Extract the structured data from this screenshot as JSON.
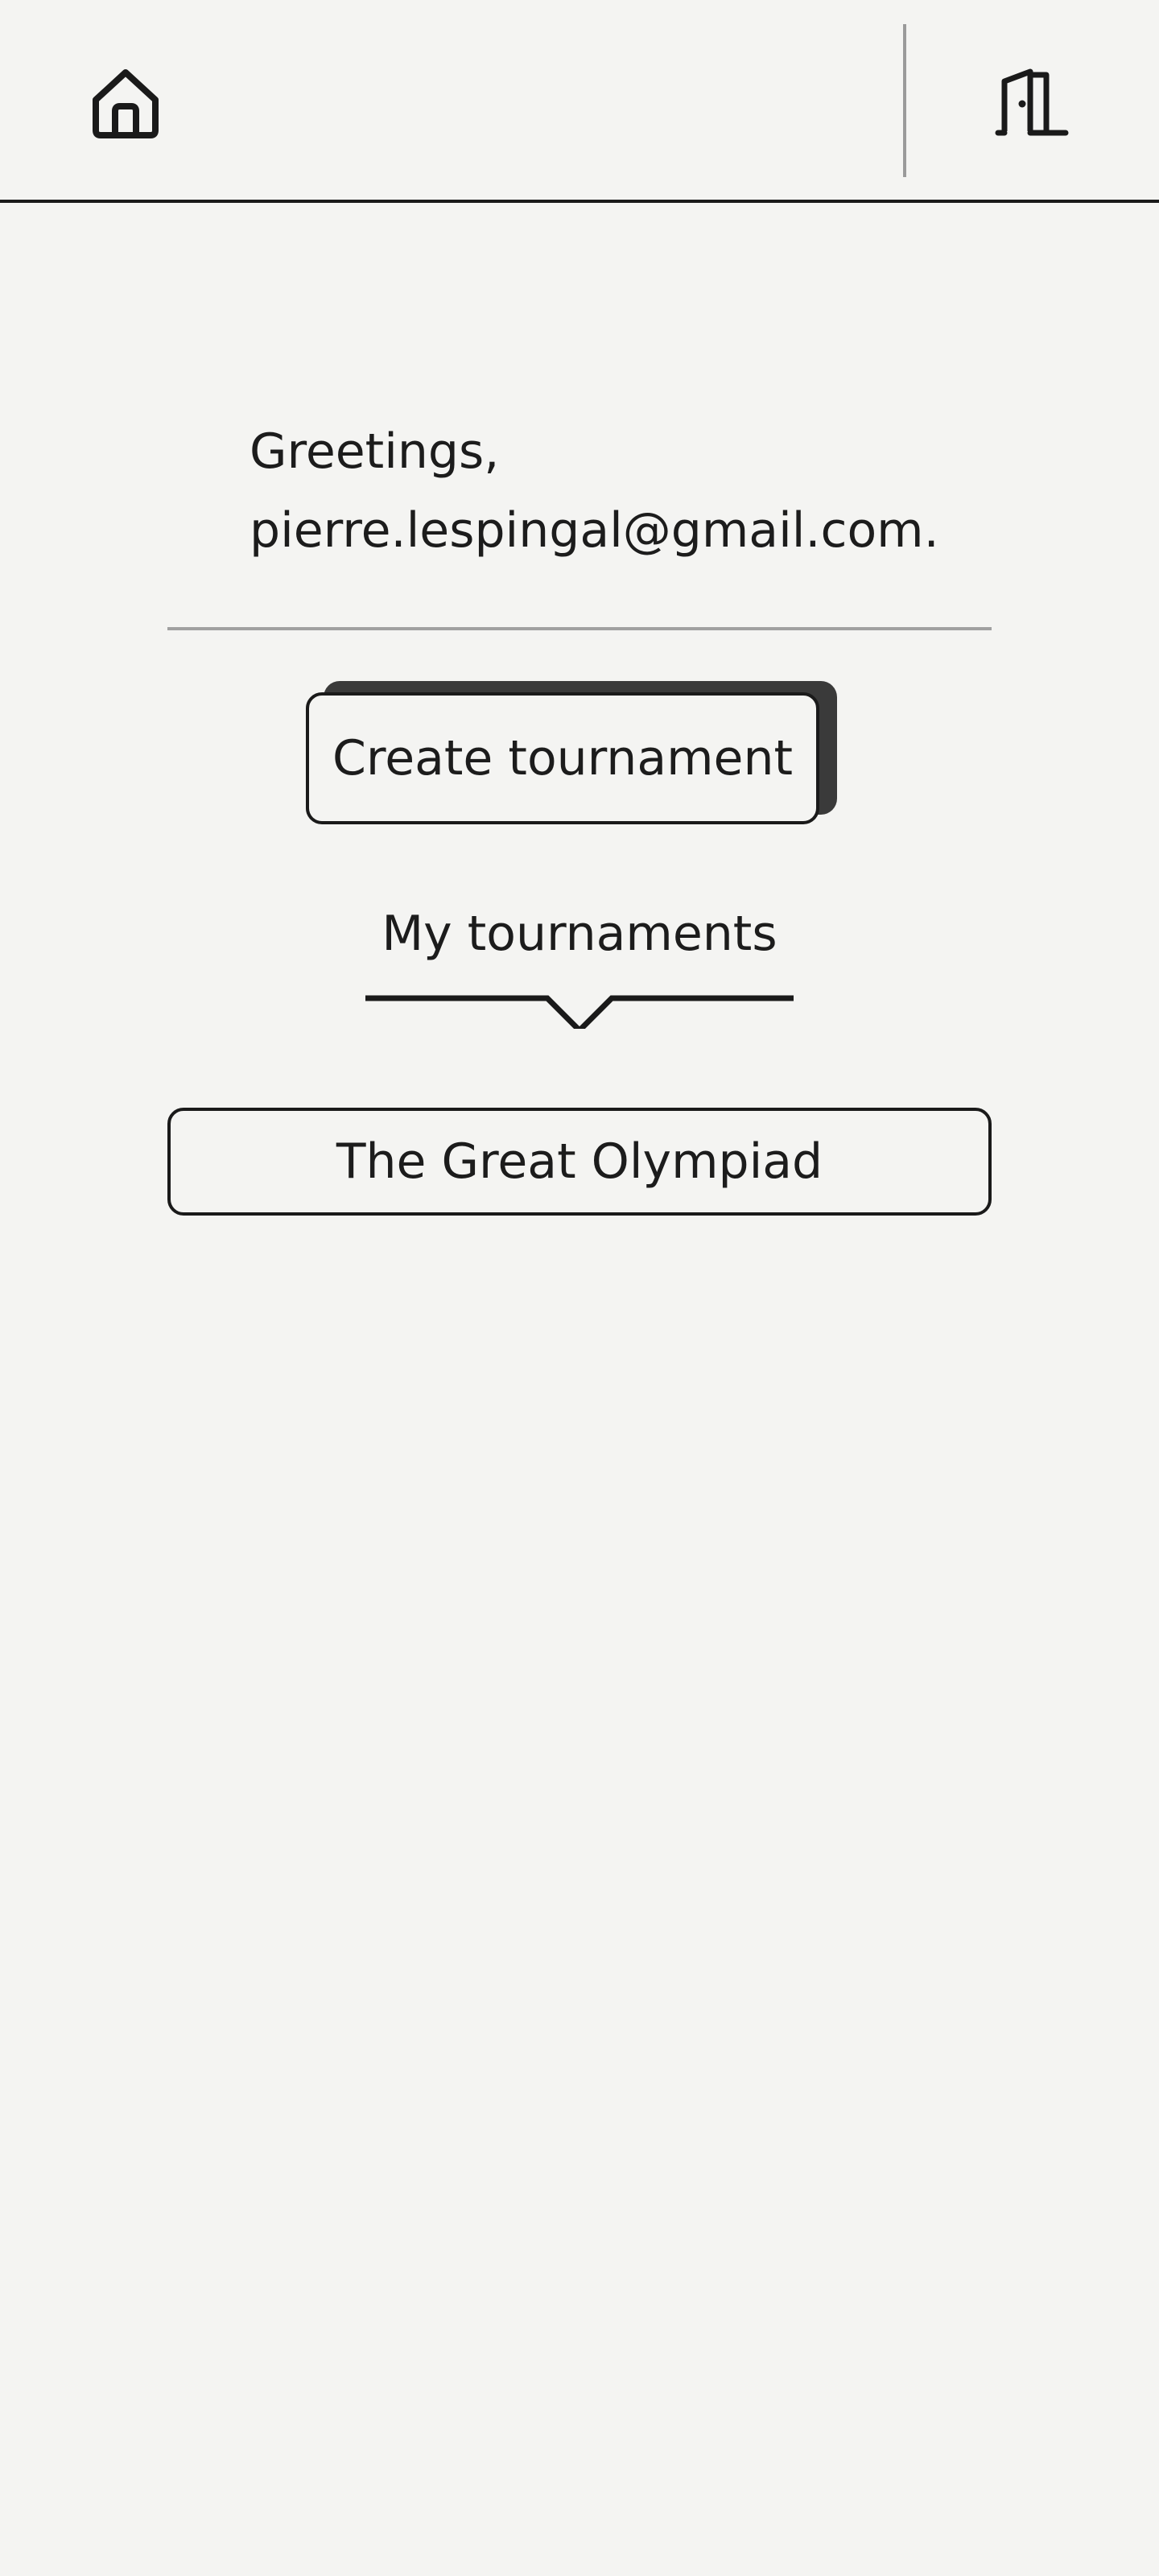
{
  "header": {
    "home_icon": "home-icon",
    "logout_icon": "door-exit-icon"
  },
  "greeting": {
    "line1": "Greetings,",
    "line2": "pierre.lespingal@gmail.com."
  },
  "actions": {
    "create_label": "Create tournament"
  },
  "section": {
    "title": "My tournaments"
  },
  "tournaments": [
    {
      "name": "The Great Olympiad"
    }
  ],
  "colors": {
    "background": "#f4f4f2",
    "text": "#1c1c1c",
    "border": "#1a1a1a",
    "divider": "#a0a0a0",
    "shadow": "#3a3a3a"
  }
}
